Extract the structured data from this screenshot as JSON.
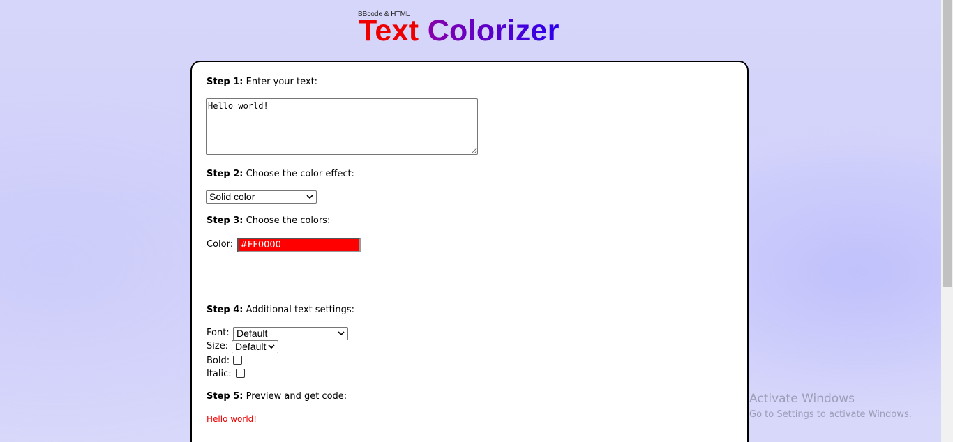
{
  "header": {
    "subtitle": "BBcode & HTML",
    "title_words": [
      {
        "text": "Text",
        "color": "#ee0000"
      },
      {
        "text": "Colorizer",
        "color": "#8800aa"
      }
    ],
    "title_gradient_end": "#2a00ee"
  },
  "step1": {
    "label": "Step 1:",
    "text": "Enter your text:",
    "textarea_value": "Hello world!"
  },
  "step2": {
    "label": "Step 2:",
    "text": "Choose the color effect:",
    "effect_selected": "Solid color"
  },
  "step3": {
    "label": "Step 3:",
    "text": "Choose the colors:",
    "color_label": "Color:",
    "color_value": "#FF0000",
    "color_text_color": "#ffffff"
  },
  "step4": {
    "label": "Step 4:",
    "text": "Additional text settings:",
    "font_label": "Font:",
    "font_selected": "Default",
    "size_label": "Size:",
    "size_selected": "Default",
    "bold_label": "Bold:",
    "bold_checked": false,
    "italic_label": "Italic:",
    "italic_checked": false
  },
  "step5": {
    "label": "Step 5:",
    "text": "Preview and get code:",
    "preview_text": "Hello world!",
    "preview_color": "#ee0000"
  },
  "watermark": {
    "line1": "Activate Windows",
    "line2": "Go to Settings to activate Windows."
  }
}
